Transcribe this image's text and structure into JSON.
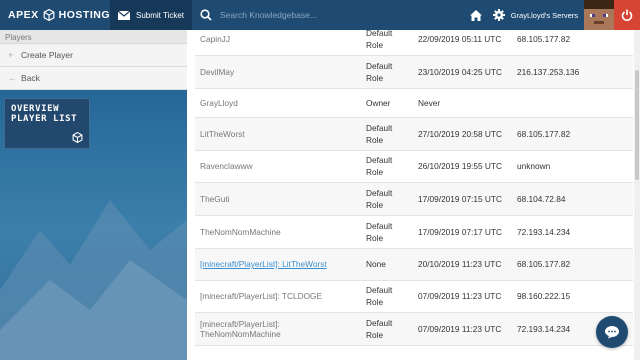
{
  "header": {
    "brand": "APEX HOSTING",
    "submit_ticket": "Submit Ticket",
    "search_placeholder": "Search Knowledgebase...",
    "servers_label": "GrayLloyd's Servers"
  },
  "sidebar": {
    "section": "Players",
    "items": [
      {
        "label": "Create Player",
        "icon": "plus-icon"
      },
      {
        "label": "Back",
        "icon": "back-arrow-icon"
      }
    ],
    "overview_line1": "OVERVIEW",
    "overview_line2": "PLAYER LIST"
  },
  "players": [
    {
      "name": "CapinJJ",
      "role": "Default Role",
      "date": "22/09/2019 05:11 UTC",
      "ip": "68.105.177.82",
      "link": false
    },
    {
      "name": "DevilMay",
      "role": "Default Role",
      "date": "23/10/2019 04:25 UTC",
      "ip": "216.137.253.136",
      "link": false
    },
    {
      "name": "GrayLloyd",
      "role": "Owner",
      "date": "Never",
      "ip": "",
      "link": false
    },
    {
      "name": "LitTheWorst",
      "role": "Default Role",
      "date": "27/10/2019 20:58 UTC",
      "ip": "68.105.177.82",
      "link": false
    },
    {
      "name": "Ravenclawww",
      "role": "Default Role",
      "date": "26/10/2019 19:55 UTC",
      "ip": "unknown",
      "link": false
    },
    {
      "name": "TheGuti",
      "role": "Default Role",
      "date": "17/09/2019 07:15 UTC",
      "ip": "68.104.72.84",
      "link": false
    },
    {
      "name": "TheNomNomMachine",
      "role": "Default Role",
      "date": "17/09/2019 07:17 UTC",
      "ip": "72.193.14.234",
      "link": false
    },
    {
      "name": "[minecraft/PlayerList]: LitTheWorst",
      "role": "None",
      "date": "20/10/2019 11:23 UTC",
      "ip": "68.105.177.82",
      "link": true
    },
    {
      "name": "[minecraft/PlayerList]: TCLDOGE",
      "role": "Default Role",
      "date": "07/09/2019 11:23 UTC",
      "ip": "98.160.222.15",
      "link": false
    },
    {
      "name": "[minecraft/PlayerList]: TheNomNomMachine",
      "role": "Default Role",
      "date": "07/09/2019 11:23 UTC",
      "ip": "72.193.14.234",
      "link": false
    }
  ],
  "colors": {
    "topbar": "#1f4b73",
    "power": "#d64434",
    "link": "#3a8fd0"
  }
}
